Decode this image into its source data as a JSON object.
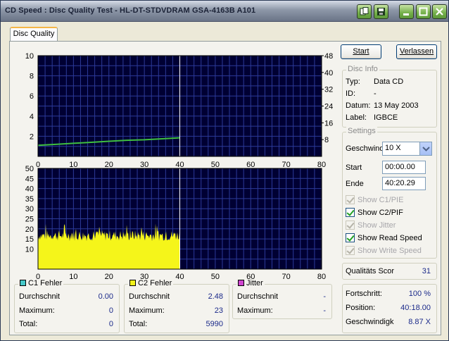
{
  "window": {
    "title": "CD Speed : Disc Quality Test - HL-DT-STDVDRAM GSA-4163B A101"
  },
  "tab": {
    "label": "Disc Quality"
  },
  "buttons": {
    "start": "Start",
    "exit": "Verlassen"
  },
  "disc_info": {
    "legend": "Disc Info",
    "rows": [
      {
        "label": "Typ:",
        "value": "Data CD"
      },
      {
        "label": "ID:",
        "value": "-"
      },
      {
        "label": "Datum:",
        "value": "13 May 2003"
      },
      {
        "label": "Label:",
        "value": "IGBCE"
      }
    ]
  },
  "settings": {
    "legend": "Settings",
    "speed_label": "Geschwind",
    "speed_value": "10 X",
    "start_label": "Start",
    "start_value": "00:00.00",
    "end_label": "Ende",
    "end_value": "40:20.29",
    "checkboxes": [
      {
        "label": "Show C1/PIE",
        "checked": true,
        "enabled": false
      },
      {
        "label": "Show C2/PIF",
        "checked": true,
        "enabled": true
      },
      {
        "label": "Show Jitter",
        "checked": true,
        "enabled": false
      },
      {
        "label": "Show Read Speed",
        "checked": true,
        "enabled": true
      },
      {
        "label": "Show Write Speed",
        "checked": true,
        "enabled": false
      }
    ]
  },
  "quality": {
    "label": "Qualitäts Scor",
    "value": "31"
  },
  "progress": {
    "rows": [
      {
        "label": "Fortschritt:",
        "value": "100 %"
      },
      {
        "label": "Position:",
        "value": "40:18.00"
      },
      {
        "label": "Geschwindigk",
        "value": "8.87 X"
      }
    ]
  },
  "stats": [
    {
      "title": "C1 Fehler",
      "color": "#46c8c8",
      "rows": [
        {
          "label": "Durchschnit",
          "value": "0.00"
        },
        {
          "label": "Maximum:",
          "value": "0"
        },
        {
          "label": "Total:",
          "value": "0"
        }
      ]
    },
    {
      "title": "C2 Fehler",
      "color": "#f2f21a",
      "rows": [
        {
          "label": "Durchschnit",
          "value": "2.48"
        },
        {
          "label": "Maximum:",
          "value": "23"
        },
        {
          "label": "Total:",
          "value": "5990"
        }
      ]
    },
    {
      "title": "Jitter",
      "color": "#d046d0",
      "rows": [
        {
          "label": "Durchschnit",
          "value": "-"
        },
        {
          "label": "Maximum:",
          "value": "-"
        }
      ]
    }
  ],
  "chart_data": [
    {
      "type": "line",
      "xlim": [
        0,
        80
      ],
      "ylim_left": [
        0,
        10
      ],
      "ylim_right": [
        0,
        48
      ],
      "x_ticks": [
        0,
        10,
        20,
        30,
        40,
        50,
        60,
        70,
        80
      ],
      "y_ticks_left": [
        2,
        4,
        6,
        8,
        10
      ],
      "y_ticks_right": [
        8,
        16,
        24,
        32,
        40,
        48
      ],
      "grid": true,
      "marker_x": 40,
      "series": [
        {
          "x": [
            0,
            5,
            10,
            15,
            20,
            25,
            30,
            35,
            40
          ],
          "y": [
            1.1,
            1.2,
            1.3,
            1.4,
            1.5,
            1.6,
            1.65,
            1.75,
            1.85
          ],
          "color": "#3fbf3f"
        }
      ]
    },
    {
      "type": "bar",
      "xlim": [
        0,
        80
      ],
      "ylim": [
        0,
        50
      ],
      "x_ticks": [
        0,
        10,
        20,
        30,
        40,
        50,
        60,
        70,
        80
      ],
      "y_ticks": [
        10,
        15,
        20,
        25,
        30,
        35,
        40,
        45,
        50
      ],
      "y_tick_labels": [
        "10",
        "15",
        "20",
        "25",
        "30",
        "35",
        "40",
        "45",
        "50"
      ],
      "grid": true,
      "marker_x": 40,
      "series": [
        {
          "name": "C2 Fehler",
          "color": "#f5f51a",
          "x_range": [
            0,
            40
          ],
          "baseline": 14,
          "max": 23
        }
      ]
    }
  ]
}
